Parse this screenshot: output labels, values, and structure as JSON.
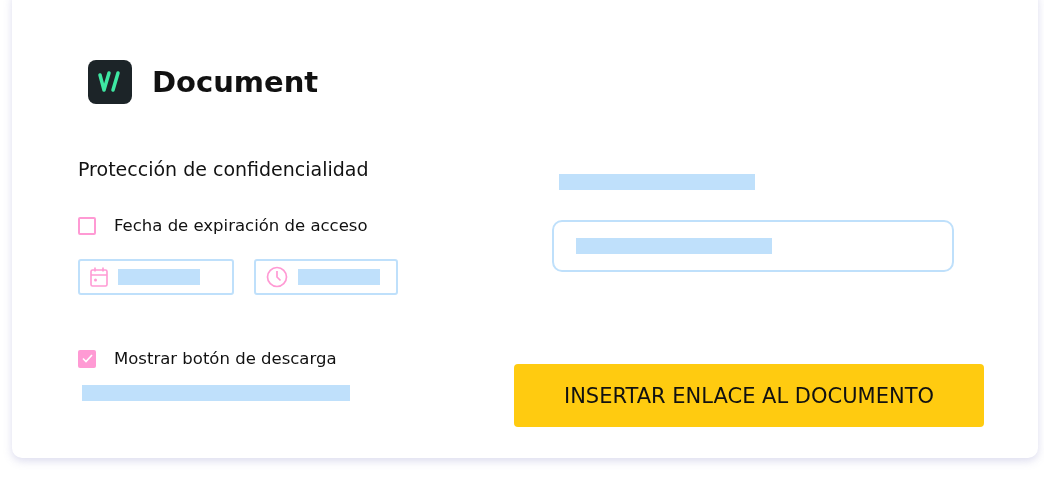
{
  "title": "Document",
  "section_title": "Protección de confidencialidad",
  "options": [
    {
      "label": "Fecha de expiración de acceso",
      "checked": false,
      "fields": [
        {
          "kind": "date"
        },
        {
          "kind": "time"
        }
      ]
    },
    {
      "label": "Mostrar botón de descarga",
      "checked": true
    }
  ],
  "button": {
    "label": "INSERTAR ENLACE AL DOCUMENTO"
  }
}
